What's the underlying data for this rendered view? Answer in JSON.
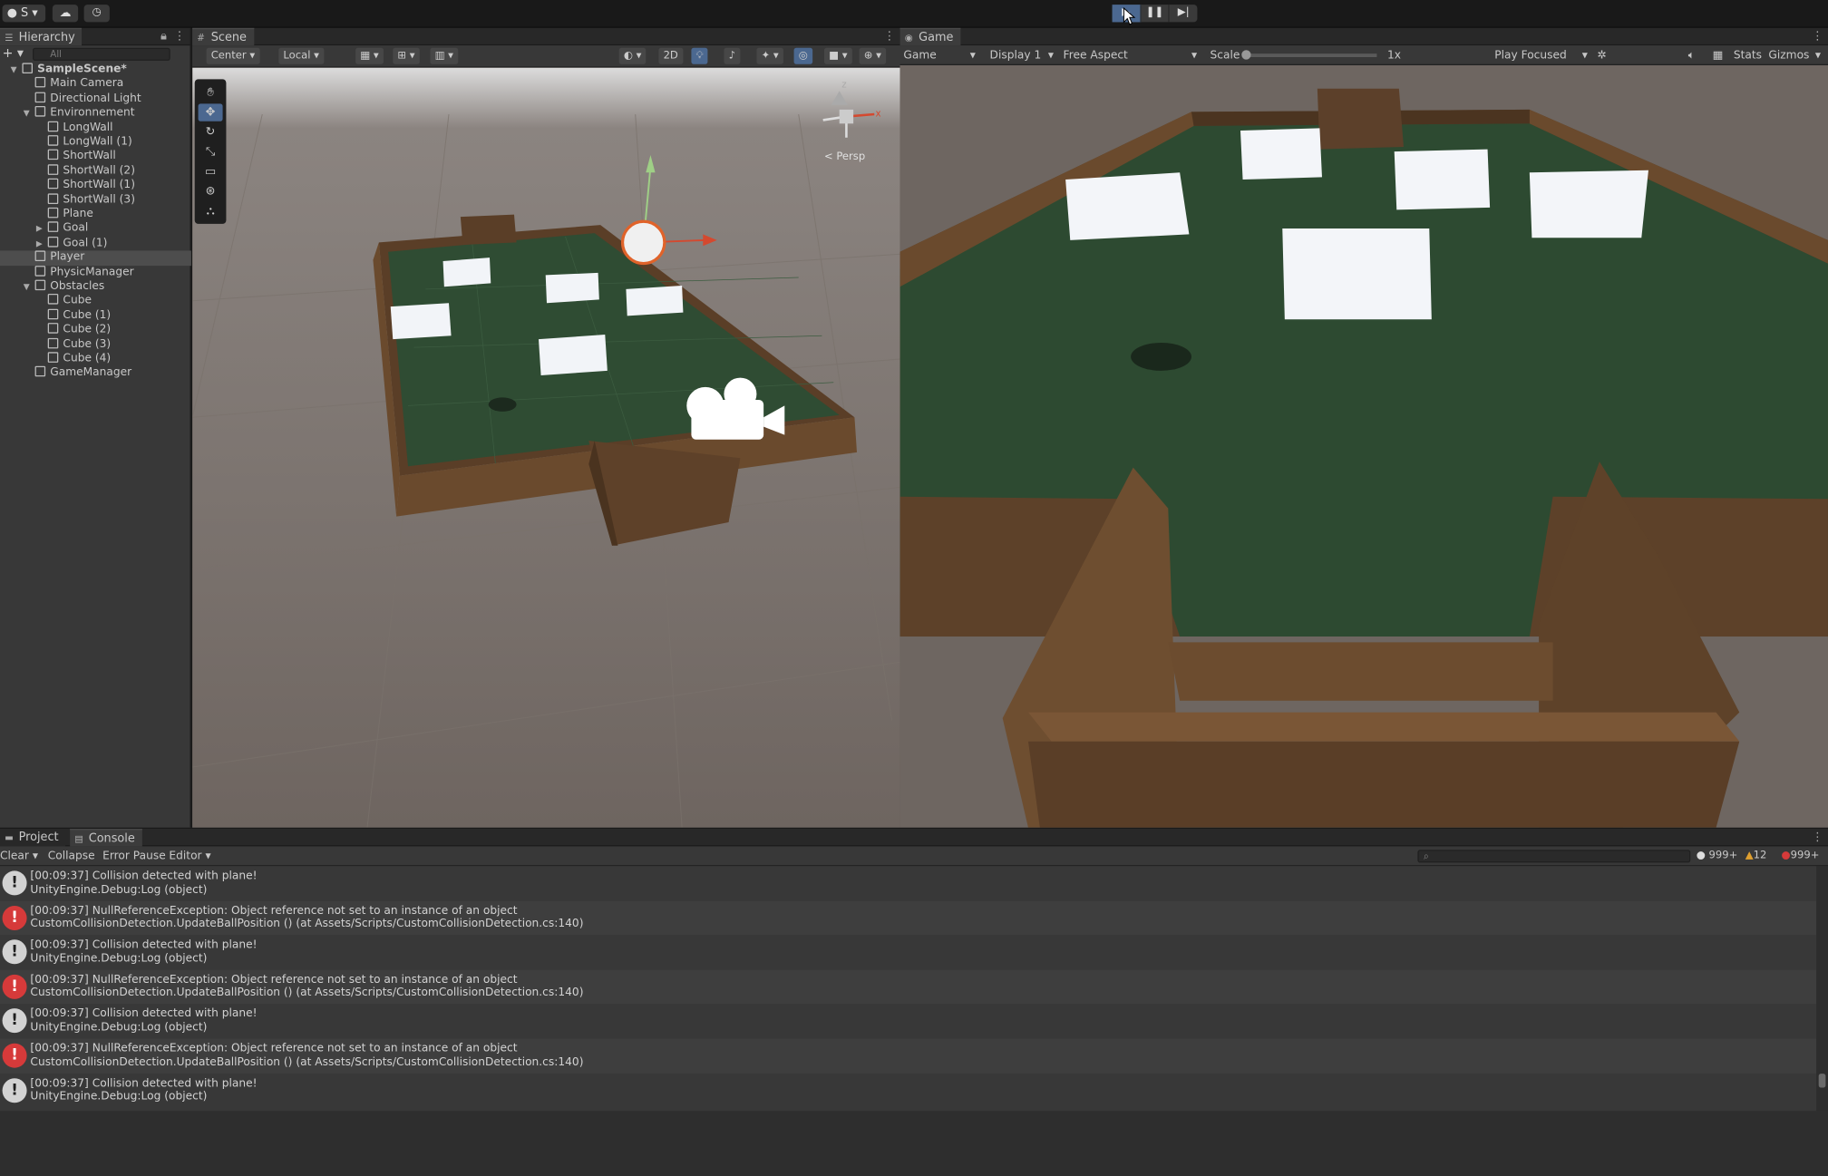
{
  "toolbar": {
    "account_label": "S",
    "cloud_icon": "cloud-icon",
    "history_icon": "history-icon",
    "play_icon": "play-icon",
    "pause_icon": "pause-icon",
    "step_icon": "step-icon"
  },
  "hierarchy": {
    "tab_label": "Hierarchy",
    "search_placeholder": "All",
    "items": [
      {
        "label": "SampleScene*",
        "indent": 0
      },
      {
        "label": "Main Camera",
        "indent": 1
      },
      {
        "label": "Directional Light",
        "indent": 1
      },
      {
        "label": "Environnement",
        "indent": 1
      },
      {
        "label": "LongWall",
        "indent": 2
      },
      {
        "label": "LongWall (1)",
        "indent": 2
      },
      {
        "label": "ShortWall",
        "indent": 2
      },
      {
        "label": "ShortWall (2)",
        "indent": 2
      },
      {
        "label": "ShortWall (1)",
        "indent": 2
      },
      {
        "label": "ShortWall (3)",
        "indent": 2
      },
      {
        "label": "Plane",
        "indent": 2
      },
      {
        "label": "Goal",
        "indent": 2
      },
      {
        "label": "Goal (1)",
        "indent": 2
      },
      {
        "label": "Player",
        "indent": 1
      },
      {
        "label": "PhysicManager",
        "indent": 1
      },
      {
        "label": "Obstacles",
        "indent": 1
      },
      {
        "label": "Cube",
        "indent": 2
      },
      {
        "label": "Cube (1)",
        "indent": 2
      },
      {
        "label": "Cube (2)",
        "indent": 2
      },
      {
        "label": "Cube (3)",
        "indent": 2
      },
      {
        "label": "Cube (4)",
        "indent": 2
      },
      {
        "label": "GameManager",
        "indent": 1
      }
    ],
    "selected": "Player"
  },
  "scene": {
    "tab_label": "Scene",
    "pivot_label": "Center",
    "space_label": "Local",
    "mode_2d": "2D",
    "persp_label": "< Persp",
    "gizmo_axes": {
      "x": "x",
      "z": "z"
    }
  },
  "game": {
    "tab_label": "Game",
    "view_select": "Game",
    "display_select": "Display 1",
    "aspect_select": "Free Aspect",
    "scale_label": "Scale",
    "scale_value": "1x",
    "scale_level": 0,
    "play_mode_select": "Play Focused",
    "stats_label": "Stats",
    "gizmos_label": "Gizmos"
  },
  "bottom": {
    "project_tab": "Project",
    "console_tab": "Console",
    "clear_label": "Clear",
    "collapse_label": "Collapse",
    "error_pause_label": "Error Pause",
    "editor_label": "Editor",
    "log_count": "999+",
    "warn_count": "12",
    "error_count": "999+"
  },
  "console": {
    "entries": [
      {
        "type": "info",
        "line1": "[00:09:37] Collision detected with plane!",
        "line2": "UnityEngine.Debug:Log (object)"
      },
      {
        "type": "error",
        "line1": "[00:09:37] NullReferenceException: Object reference not set to an instance of an object",
        "line2": "CustomCollisionDetection.UpdateBallPosition () (at Assets/Scripts/CustomCollisionDetection.cs:140)"
      },
      {
        "type": "info",
        "line1": "[00:09:37] Collision detected with plane!",
        "line2": "UnityEngine.Debug:Log (object)"
      },
      {
        "type": "error",
        "line1": "[00:09:37] NullReferenceException: Object reference not set to an instance of an object",
        "line2": "CustomCollisionDetection.UpdateBallPosition () (at Assets/Scripts/CustomCollisionDetection.cs:140)"
      },
      {
        "type": "info",
        "line1": "[00:09:37] Collision detected with plane!",
        "line2": "UnityEngine.Debug:Log (object)"
      },
      {
        "type": "error",
        "line1": "[00:09:37] NullReferenceException: Object reference not set to an instance of an object",
        "line2": "CustomCollisionDetection.UpdateBallPosition () (at Assets/Scripts/CustomCollisionDetection.cs:140)"
      },
      {
        "type": "info",
        "line1": "[00:09:37] Collision detected with plane!",
        "line2": "UnityEngine.Debug:Log (object)"
      }
    ]
  },
  "colors": {
    "selection": "#4d4d4d",
    "play_active": "#4b6890",
    "error": "#d63a3a",
    "warning": "#e0a030",
    "board_green": "#2f4c33",
    "wall_brown": "#6a4a2d"
  }
}
